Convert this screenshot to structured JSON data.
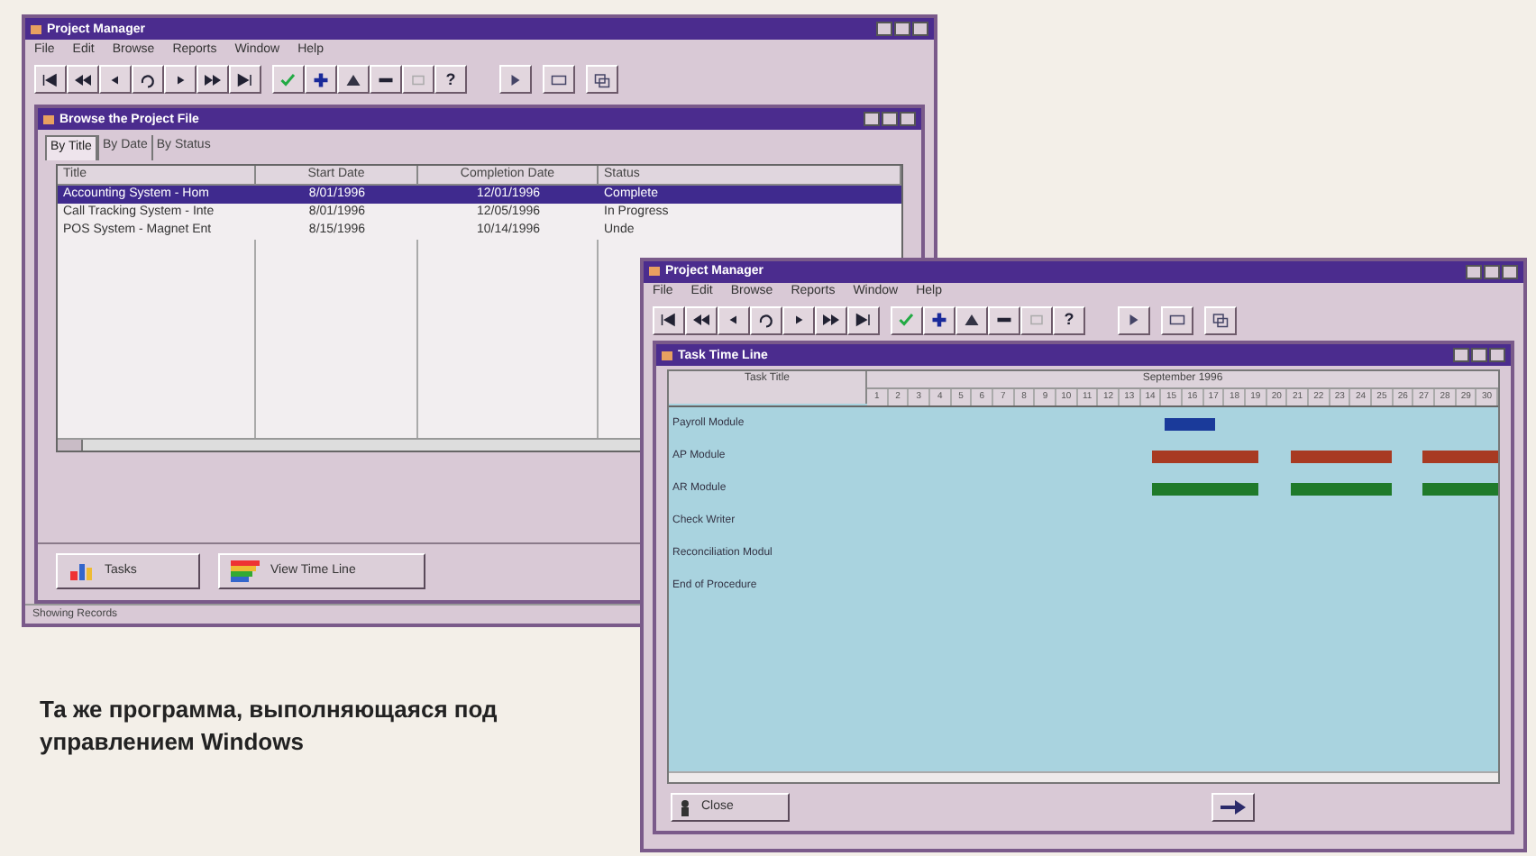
{
  "browse_window": {
    "title": "Project Manager",
    "menu": [
      "File",
      "Edit",
      "Browse",
      "Reports",
      "Window",
      "Help"
    ],
    "toolbar_help": "?",
    "child": {
      "title": "Browse the Project File",
      "tabs": [
        {
          "label": "By Title",
          "selected": true
        },
        {
          "label": "By Date",
          "selected": false
        },
        {
          "label": "By Status",
          "selected": false
        }
      ],
      "columns": [
        "Title",
        "Start Date",
        "Completion Date",
        "Status"
      ],
      "rows": [
        {
          "cells": [
            "Accounting System - Hom",
            "8/01/1996",
            "12/01/1996",
            "Complete"
          ],
          "selected": true
        },
        {
          "cells": [
            "Call Tracking System - Inte",
            "8/01/1996",
            "12/05/1996",
            "In Progress"
          ],
          "selected": false
        },
        {
          "cells": [
            "POS System - Magnet Ent",
            "8/15/1996",
            "10/14/1996",
            "Unde"
          ],
          "selected": false
        }
      ],
      "buttons": [
        {
          "label": "Tasks",
          "kind": "tasks"
        },
        {
          "label": "View Time Line",
          "kind": "timeline"
        }
      ]
    },
    "status_bar": "Showing Records"
  },
  "timeline_window": {
    "title": "Project Manager",
    "menu": [
      "File",
      "Edit",
      "Browse",
      "Reports",
      "Window",
      "Help"
    ],
    "toolbar_help": "?",
    "child": {
      "title": "Task Time Line",
      "task_column": "Task Title",
      "month": "September 1996",
      "days": [
        "1",
        "2",
        "3",
        "4",
        "5",
        "6",
        "7",
        "8",
        "9",
        "10",
        "11",
        "12",
        "13",
        "14",
        "15",
        "16",
        "17",
        "18",
        "19",
        "20",
        "21",
        "22",
        "23",
        "24",
        "25",
        "26",
        "27",
        "28",
        "29",
        "30"
      ],
      "tasks": [
        {
          "title": "Payroll Module",
          "color": "#1a3a9a"
        },
        {
          "title": "AP Module",
          "color": "#a83a22"
        },
        {
          "title": "AR Module",
          "color": "#1f7a2a"
        },
        {
          "title": "Check Writer"
        },
        {
          "title": "Reconciliation Modul"
        },
        {
          "title": "End of Procedure"
        }
      ],
      "close_button": "Close"
    }
  },
  "caption": "Та же программа, выполняющаяся под управлением Windows"
}
